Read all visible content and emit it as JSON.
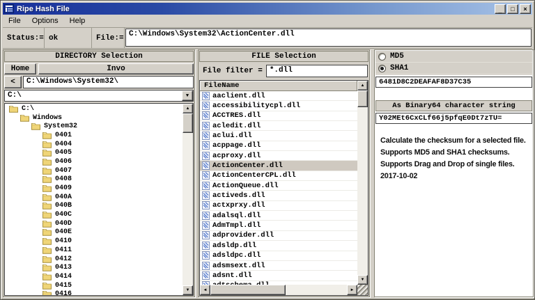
{
  "window": {
    "title": "Ripe Hash File",
    "minimize_glyph": "_",
    "maximize_glyph": "□",
    "close_glyph": "×"
  },
  "menu": {
    "items": [
      "File",
      "Options",
      "Help"
    ]
  },
  "status_bar": {
    "status_label": "Status:=",
    "status_value": "ok",
    "file_label": "File:=",
    "file_path": "C:\\Windows\\System32\\ActionCenter.dll"
  },
  "directory_panel": {
    "title": "DIRECTORY Selection",
    "home_button": "Home",
    "invo_button": "Invo",
    "back_button": "<",
    "path": "C:\\Windows\\System32\\",
    "combo_value": "C:\\",
    "tree": [
      {
        "label": "C:\\",
        "indent": 0
      },
      {
        "label": "Windows",
        "indent": 1
      },
      {
        "label": "System32",
        "indent": 2
      },
      {
        "label": "0401",
        "indent": 3
      },
      {
        "label": "0404",
        "indent": 3
      },
      {
        "label": "0405",
        "indent": 3
      },
      {
        "label": "0406",
        "indent": 3
      },
      {
        "label": "0407",
        "indent": 3
      },
      {
        "label": "0408",
        "indent": 3
      },
      {
        "label": "0409",
        "indent": 3
      },
      {
        "label": "040A",
        "indent": 3
      },
      {
        "label": "040B",
        "indent": 3
      },
      {
        "label": "040C",
        "indent": 3
      },
      {
        "label": "040D",
        "indent": 3
      },
      {
        "label": "040E",
        "indent": 3
      },
      {
        "label": "0410",
        "indent": 3
      },
      {
        "label": "0411",
        "indent": 3
      },
      {
        "label": "0412",
        "indent": 3
      },
      {
        "label": "0413",
        "indent": 3
      },
      {
        "label": "0414",
        "indent": 3
      },
      {
        "label": "0415",
        "indent": 3
      },
      {
        "label": "0416",
        "indent": 3
      }
    ]
  },
  "file_panel": {
    "title": "FILE Selection",
    "filter_label": "File filter =",
    "filter_value": "*.dll",
    "column_header": "FileName",
    "selected_file": "ActionCenter.dll",
    "files": [
      "aaclient.dll",
      "accessibilitycpl.dll",
      "ACCTRES.dll",
      "acledit.dll",
      "aclui.dll",
      "acppage.dll",
      "acproxy.dll",
      "ActionCenter.dll",
      "ActionCenterCPL.dll",
      "ActionQueue.dll",
      "activeds.dll",
      "actxprxy.dll",
      "adalsql.dll",
      "AdmTmpl.dll",
      "adprovider.dll",
      "adsldp.dll",
      "adsldpc.dll",
      "adsmsext.dll",
      "adsnt.dll",
      "adtschema.dll"
    ]
  },
  "hash_panel": {
    "md5_label": "MD5",
    "sha1_label": "SHA1",
    "selected_algorithm": "SHA1",
    "hash_value": "6481D8C2DEAFAF8D37C35",
    "binary64_header": "As Binary64 character string",
    "binary64_value": "Y02MEt6CxCLf66j5pfqE0Dt7zTU=",
    "description_lines": [
      "Calculate the checksum for a selected file.",
      "Supports MD5 and SHA1 checksums.",
      "Supports Drag and Drop of single files.",
      "2017-10-02"
    ]
  },
  "icons": {
    "scroll_up": "▲",
    "scroll_down": "▼",
    "scroll_left": "◄",
    "scroll_right": "►",
    "dropdown": "▼"
  },
  "colors": {
    "titlebar_left": "#17309b",
    "titlebar_right": "#a9c4e8",
    "window_gray": "#d4d0c8",
    "selected_row": "#cfc9c0",
    "folder_yellow": "#efd578"
  }
}
